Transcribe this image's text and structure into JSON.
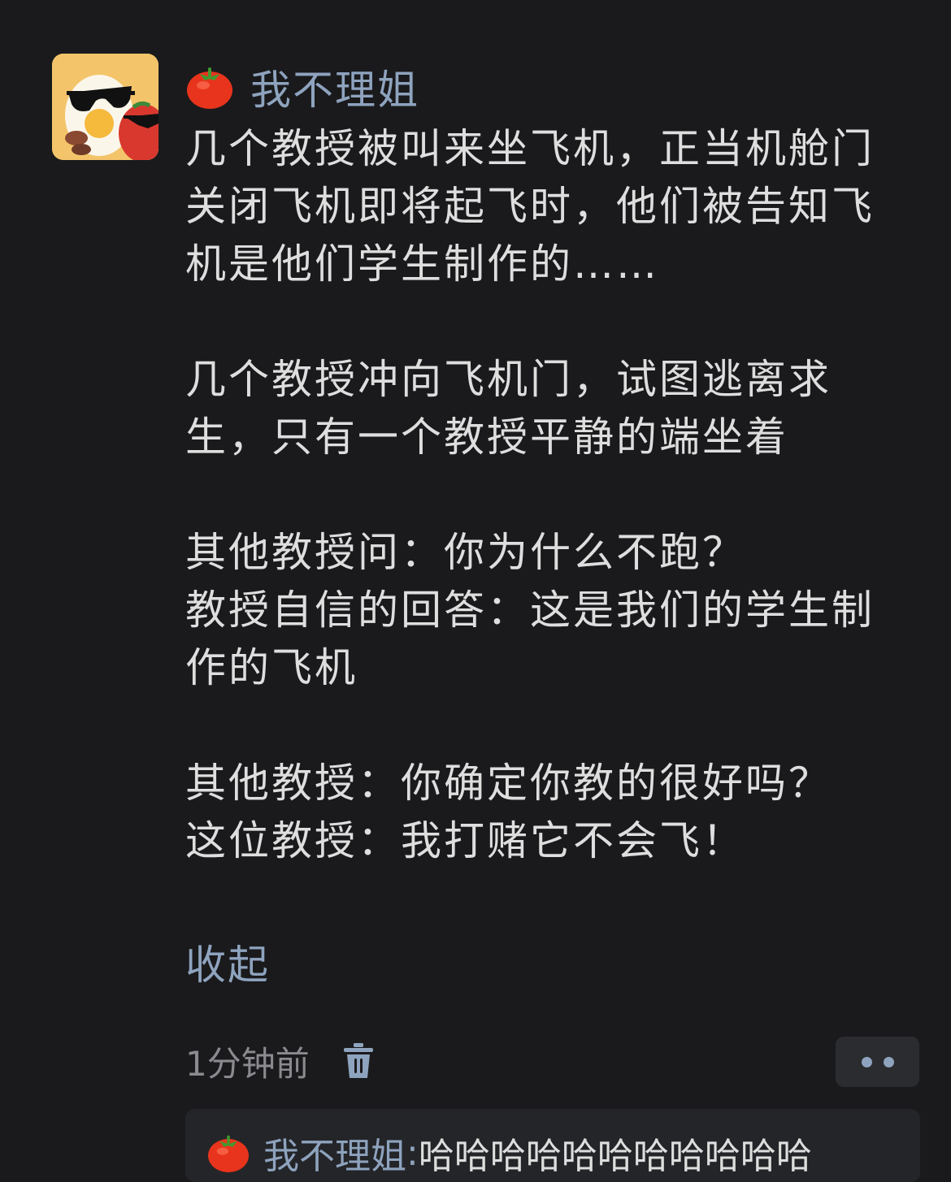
{
  "comment": {
    "author_name": "我不理姐",
    "avatar_icon": "sunglasses-egg-avatar",
    "name_badge_icon": "tomato-icon",
    "paragraphs": [
      [
        "几个教授被叫来坐飞机，正当机舱门",
        "关闭飞机即将起飞时，他们被告知飞",
        "机是他们学生制作的……"
      ],
      [
        "几个教授冲向飞机门，试图逃离求",
        "生，只有一个教授平静的端坐着"
      ],
      [
        "其他教授问：你为什么不跑？",
        "教授自信的回答：这是我们的学生制",
        "作的飞机"
      ],
      [
        "其他教授：你确定你教的很好吗？",
        "这位教授：我打赌它不会飞！"
      ]
    ],
    "collapse_label": "收起",
    "time": "1分钟前",
    "delete_icon": "trash-icon",
    "more_icon": "more-dots-icon"
  },
  "reply": {
    "author_name": "我不理姐",
    "separator": ":",
    "text": "哈哈哈哈哈哈哈哈哈哈哈",
    "badge_icon": "tomato-icon"
  },
  "colors": {
    "background": "#1a1a1c",
    "link_blue": "#8ea3be",
    "text": "#dedede",
    "meta_gray": "#8a8a8f",
    "button_bg": "#2b2c30",
    "reply_bg": "#242528"
  }
}
